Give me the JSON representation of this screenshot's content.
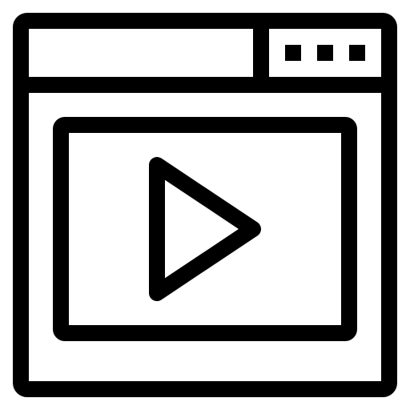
{
  "icon": {
    "name": "browser-video-icon",
    "stroke_color": "#000000",
    "fill_color": "#ffffff",
    "parts": {
      "window": "browser-window-icon",
      "menu_dots": "ellipsis-icon",
      "video_frame": "video-frame-icon",
      "play": "play-icon"
    },
    "menu_dot_count": 3
  }
}
